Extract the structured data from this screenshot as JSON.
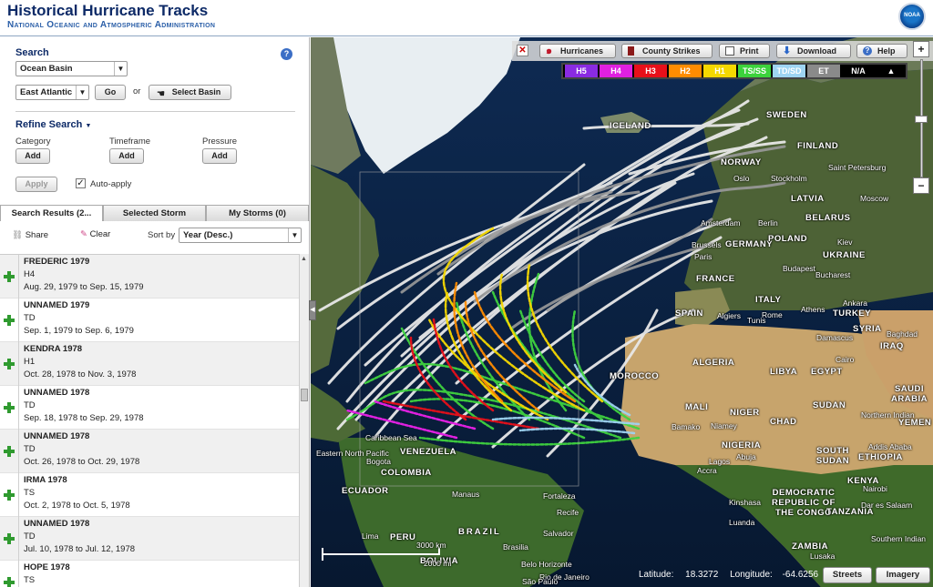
{
  "header": {
    "title": "Historical Hurricane Tracks",
    "subtitle": "National Oceanic and Atmospheric Administration",
    "logo_text": "NOAA"
  },
  "search": {
    "heading": "Search",
    "help_icon": "?",
    "basin_type": "Ocean Basin",
    "basin": "East Atlantic",
    "go_label": "Go",
    "or_text": "or",
    "select_basin_label": "Select Basin"
  },
  "refine": {
    "heading": "Refine Search",
    "category_label": "Category",
    "timeframe_label": "Timeframe",
    "pressure_label": "Pressure",
    "add_label": "Add",
    "apply_label": "Apply",
    "auto_apply_label": "Auto-apply",
    "auto_apply_checked": true
  },
  "tabs": [
    {
      "label": "Search Results (2..."
    },
    {
      "label": "Selected Storm"
    },
    {
      "label": "My Storms (0)"
    }
  ],
  "results_toolbar": {
    "share_label": "Share",
    "clear_label": "Clear",
    "sort_label": "Sort by",
    "sort_value": "Year (Desc.)"
  },
  "results": [
    {
      "name": "FREDERIC 1979",
      "category": "H4",
      "dates": "Aug. 29, 1979 to Sep. 15, 1979"
    },
    {
      "name": "UNNAMED 1979",
      "category": "TD",
      "dates": "Sep. 1, 1979 to Sep. 6, 1979"
    },
    {
      "name": "KENDRA 1978",
      "category": "H1",
      "dates": "Oct. 28, 1978 to Nov. 3, 1978"
    },
    {
      "name": "UNNAMED 1978",
      "category": "TD",
      "dates": "Sep. 18, 1978 to Sep. 29, 1978"
    },
    {
      "name": "UNNAMED 1978",
      "category": "TD",
      "dates": "Oct. 26, 1978 to Oct. 29, 1978"
    },
    {
      "name": "IRMA 1978",
      "category": "TS",
      "dates": "Oct. 2, 1978 to Oct. 5, 1978"
    },
    {
      "name": "UNNAMED 1978",
      "category": "TD",
      "dates": "Jul. 10, 1978 to Jul. 12, 1978"
    },
    {
      "name": "HOPE 1978",
      "category": "TS",
      "dates": ""
    }
  ],
  "map_toolbar": {
    "hurricanes_label": "Hurricanes",
    "county_strikes_label": "County Strikes",
    "print_label": "Print",
    "download_label": "Download",
    "help_label": "Help"
  },
  "legend": [
    {
      "label": "H5",
      "color": "#8a2be2"
    },
    {
      "label": "H4",
      "color": "#e020e0"
    },
    {
      "label": "H3",
      "color": "#e8101a"
    },
    {
      "label": "H2",
      "color": "#ff8c00"
    },
    {
      "label": "H1",
      "color": "#f5d800"
    },
    {
      "label": "TS/SS",
      "color": "#3cd23c"
    },
    {
      "label": "TD/SD",
      "color": "#9ed4f2"
    },
    {
      "label": "ET",
      "color": "#8a8a8a"
    },
    {
      "label": "N/A",
      "color": "#000000"
    }
  ],
  "map": {
    "latitude_label": "Latitude:",
    "latitude": "18.3272",
    "longitude_label": "Longitude:",
    "longitude": "-64.6256",
    "streets_label": "Streets",
    "imagery_label": "Imagery",
    "scale_km": "3000 km",
    "scale_mi": "2000 mi",
    "zoom_in": "+",
    "zoom_out": "−",
    "labels": {
      "iceland": "ICELAND",
      "sweden": "SWEDEN",
      "finland": "FINLAND",
      "norway": "NORWAY",
      "st_petersburg": "Saint Petersburg",
      "oslo": "Oslo",
      "stockholm": "Stockholm",
      "latvia": "LATVIA",
      "moscow": "Moscow",
      "amsterdam": "Amsterdam",
      "berlin": "Berlin",
      "belarus": "BELARUS",
      "brussels": "Brussels",
      "germany": "GERMANY",
      "poland": "POLAND",
      "kiev": "Kiev",
      "paris": "Paris",
      "ukraine": "UKRAINE",
      "budapest": "Budapest",
      "france": "FRANCE",
      "bucharest": "Bucharest",
      "italy": "ITALY",
      "spain": "SPAIN",
      "rome": "Rome",
      "athens": "Athens",
      "ankara": "Ankara",
      "turkey": "TURKEY",
      "algiers": "Algiers",
      "tunis": "Tunis",
      "syria": "SYRIA",
      "baghdad": "Baghdad",
      "damascus": "Damascus",
      "iraq": "IRAQ",
      "morocco": "MOROCCO",
      "algeria": "ALGERIA",
      "libya": "LIBYA",
      "egypt": "EGYPT",
      "cairo": "Cairo",
      "saudi": "SAUDI ARABIA",
      "mali": "MALI",
      "niger": "NIGER",
      "chad": "CHAD",
      "sudan": "SUDAN",
      "northern_indian": "Northern Indian",
      "yemen": "YEMEN",
      "bamako": "Bamako",
      "niamey": "Niamey",
      "nigeria": "NIGERIA",
      "abuja": "Abuja",
      "south_sudan": "SOUTH SUDAN",
      "ethiopia": "ETHIOPIA",
      "addis": "Addis Ababa",
      "lagos": "Lagos",
      "accra": "Accra",
      "kenya": "KENYA",
      "nairobi": "Nairobi",
      "drc": "DEMOCRATIC REPUBLIC OF THE CONGO",
      "kinshasa": "Kinshasa",
      "tanzania": "TANZANIA",
      "dar": "Dar es Salaam",
      "luanda": "Luanda",
      "zambia": "ZAMBIA",
      "lusaka": "Lusaka",
      "southern_indian": "Southern Indian",
      "caribbean": "Caribbean Sea",
      "eastern_north_pacific": "Eastern North Pacific",
      "venezuela": "VENEZUELA",
      "bogota": "Bogota",
      "colombia": "COLOMBIA",
      "ecuador": "ECUADOR",
      "manaus": "Manaus",
      "fortaleza": "Fortaleza",
      "recife": "Recife",
      "brazil": "BRAZIL",
      "salvador": "Salvador",
      "lima": "Lima",
      "peru": "PERU",
      "brasilia": "Brasilia",
      "belo": "Belo Horizonte",
      "rio": "Rio de Janeiro",
      "sao_paulo": "São Paulo",
      "bolivia": "BOLIVIA"
    }
  }
}
